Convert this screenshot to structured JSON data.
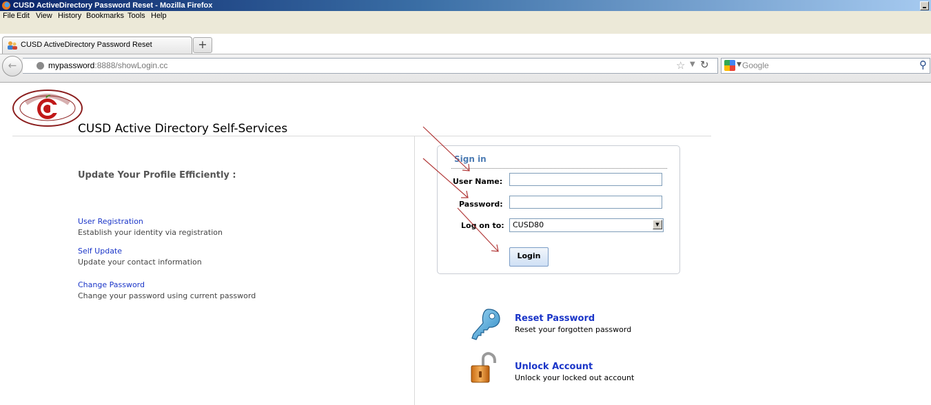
{
  "window": {
    "title": "CUSD ActiveDirectory Password Reset - Mozilla Firefox"
  },
  "menubar": {
    "items": [
      "File",
      "Edit",
      "View",
      "History",
      "Bookmarks",
      "Tools",
      "Help"
    ]
  },
  "tab": {
    "title": "CUSD ActiveDirectory Password Reset",
    "new_tab": "+"
  },
  "navbar": {
    "url_host": "mypassword",
    "url_rest": ":8888/showLogin.cc",
    "search_placeholder": "Google",
    "icons": [
      "back-arrow-icon",
      "globe-icon",
      "bookmark-star-icon",
      "reload-icon",
      "google-icon",
      "search-icon"
    ]
  },
  "page": {
    "logo": {
      "text": "CHANDLER UNIFIED SCHOOL DISTRICT"
    },
    "title": "CUSD Active Directory Self-Services",
    "tagline": "Update Your Profile Efficiently :",
    "links": [
      {
        "label": "User Registration",
        "desc": "Establish your identity via registration"
      },
      {
        "label": "Self Update",
        "desc": "Update your contact information"
      },
      {
        "label": "Change Password",
        "desc": "Change your password using current password"
      }
    ],
    "signin": {
      "title": "Sign in",
      "username_label": "User Name:",
      "username_value": "",
      "password_label": "Password:",
      "password_value": "",
      "logon_label": "Log on to:",
      "logon_value": "CUSD80",
      "login_button": "Login"
    },
    "actions": [
      {
        "label": "Reset Password",
        "desc": "Reset your forgotten password",
        "icon": "key-icon"
      },
      {
        "label": "Unlock Account",
        "desc": "Unlock your locked out account",
        "icon": "padlock-icon"
      }
    ],
    "annotation_color": "#b23a3a"
  }
}
